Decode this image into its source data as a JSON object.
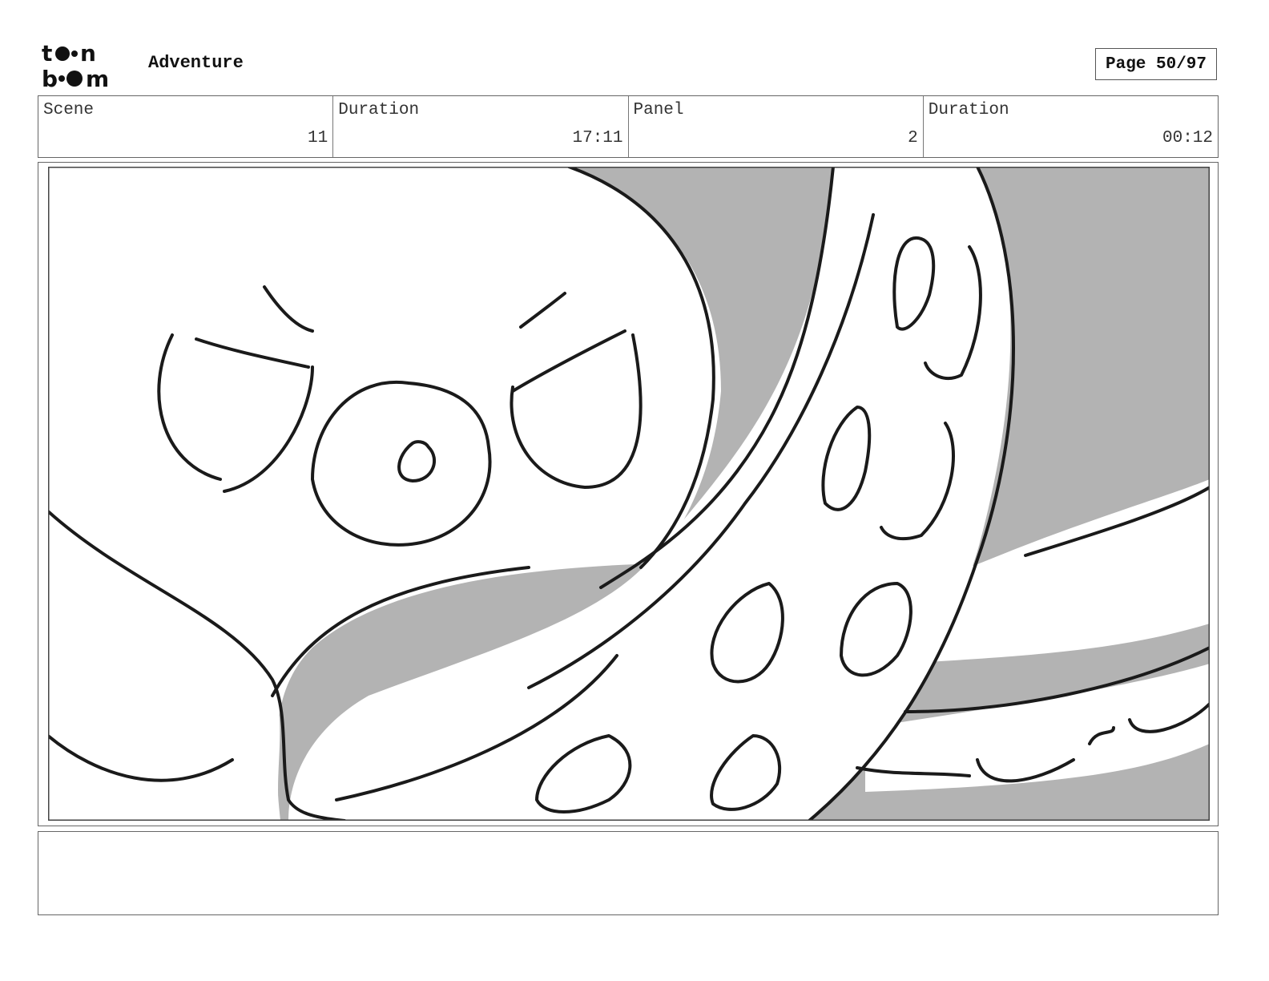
{
  "header": {
    "logo_alt": "toon boom",
    "project_title": "Adventure",
    "page_indicator": "Page 50/97"
  },
  "info": {
    "scene_label": "Scene",
    "scene_value": "11",
    "scene_duration_label": "Duration",
    "scene_duration_value": "17:11",
    "panel_label": "Panel",
    "panel_value": "2",
    "panel_duration_label": "Duration",
    "panel_duration_value": "00:12"
  },
  "panel": {
    "image_description": "octopus-close-up-sketch",
    "background_color": "#b3b3b3",
    "ink_color": "#1a1a1a"
  },
  "notes": {
    "text": ""
  }
}
